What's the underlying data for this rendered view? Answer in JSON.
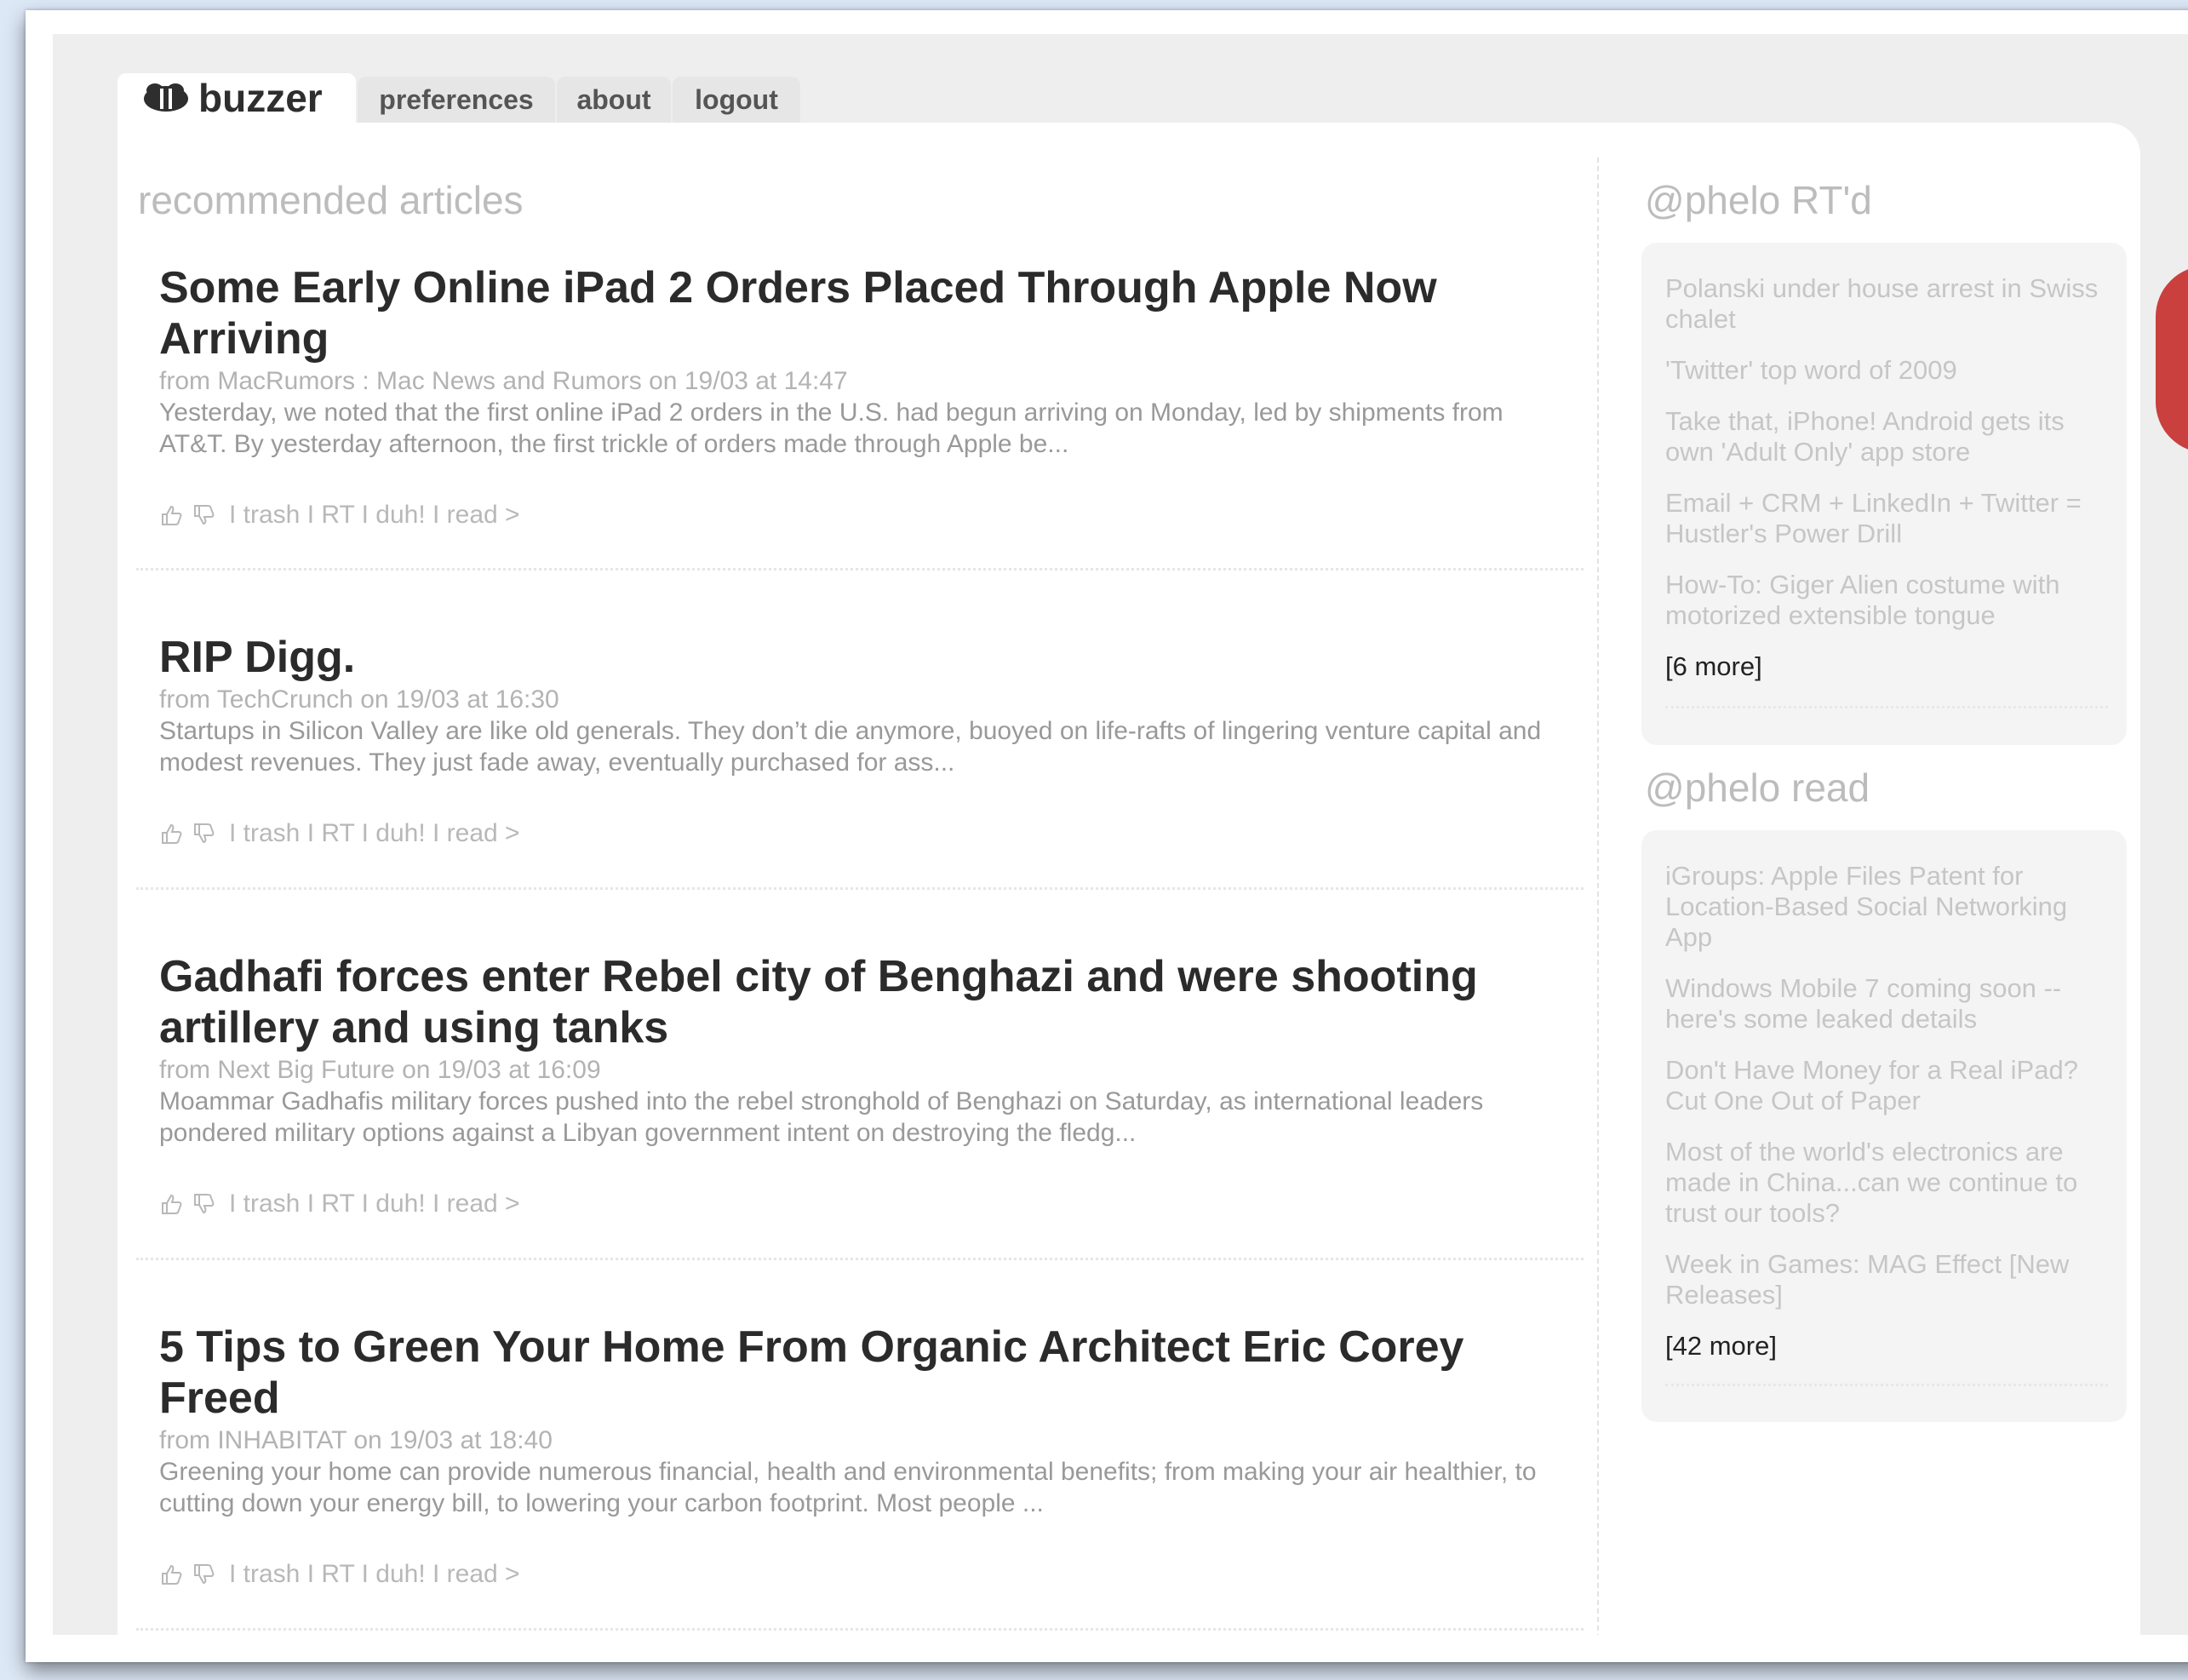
{
  "nav": {
    "logo": "buzzer",
    "tabs": [
      "preferences",
      "about",
      "logout"
    ]
  },
  "main": {
    "title": "recommended articles",
    "articles": [
      {
        "title": "Some Early Online iPad 2 Orders Placed Through Apple Now Arriving",
        "source": "from MacRumors : Mac News and Rumors on 19/03 at 14:47",
        "excerpt": "Yesterday, we noted that the first online iPad 2 orders in the U.S. had begun arriving on Monday, led by shipments from AT&T. By yesterday afternoon, the first trickle of orders made through Apple be...",
        "actions": "I trash I RT I duh! I read >"
      },
      {
        "title": "RIP Digg.",
        "source": "from TechCrunch on 19/03 at 16:30",
        "excerpt": "Startups in Silicon Valley are like old generals. They don’t die anymore, buoyed on life-rafts of lingering venture capital and modest revenues. They just fade away, eventually purchased for ass...",
        "actions": "I trash I RT I duh! I read >"
      },
      {
        "title": "Gadhafi forces enter Rebel city of Benghazi and were shooting artillery and using tanks",
        "source": "from Next Big Future on 19/03 at 16:09",
        "excerpt": "Moammar Gadhafis military forces pushed into the rebel stronghold of Benghazi on Saturday, as international leaders pondered military options against a Libyan government intent on destroying the fledg...",
        "actions": "I trash I RT I duh! I read >"
      },
      {
        "title": "5 Tips to Green Your Home From Organic Architect Eric Corey Freed",
        "source": "from INHABITAT on 19/03 at 18:40",
        "excerpt": "Greening your home can provide numerous financial, health and environmental benefits; from making your air healthier, to cutting down your energy bill, to lowering your carbon footprint. Most people ...",
        "actions": "I trash I RT I duh! I read >"
      }
    ]
  },
  "sidebar": {
    "rtd": {
      "title": "@phelo RT'd",
      "items": [
        "Polanski under house arrest in Swiss chalet",
        "'Twitter' top word of 2009",
        "Take that, iPhone! Android gets its own 'Adult Only' app store",
        "Email + CRM + LinkedIn + Twitter = Hustler's Power Drill",
        "How-To: Giger Alien costume with motorized extensible tongue"
      ],
      "more": "[6 more]"
    },
    "read": {
      "title": "@phelo read",
      "items": [
        "iGroups: Apple Files Patent for Location-Based Social Networking App",
        "Windows Mobile 7 coming soon -- here's some leaked details",
        "Don't Have Money for a Real iPad? Cut One Out of Paper",
        "Most of the world's electronics are made in China...can we continue to trust our tools?",
        "Week in Games: MAG Effect [New Releases]"
      ],
      "more": "[42 more]"
    }
  },
  "icons": {
    "logo": "bee-icon",
    "thumbs_up": "thumbs-up-icon",
    "thumbs_down": "thumbs-down-icon"
  },
  "colors": {
    "accent_red": "#c9403e",
    "page_bg": "#dde8f7"
  }
}
